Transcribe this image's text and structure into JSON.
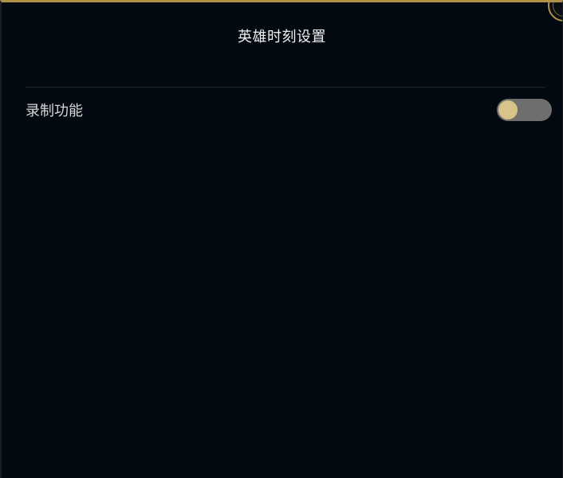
{
  "dialog": {
    "title": "英雄时刻设置"
  },
  "settings": {
    "recording": {
      "label": "录制功能",
      "enabled": false
    }
  },
  "colors": {
    "background": "#030910",
    "accent_gold": "#b0914a",
    "toggle_track": "#6e6e6e",
    "toggle_knob": "#d8c389"
  }
}
